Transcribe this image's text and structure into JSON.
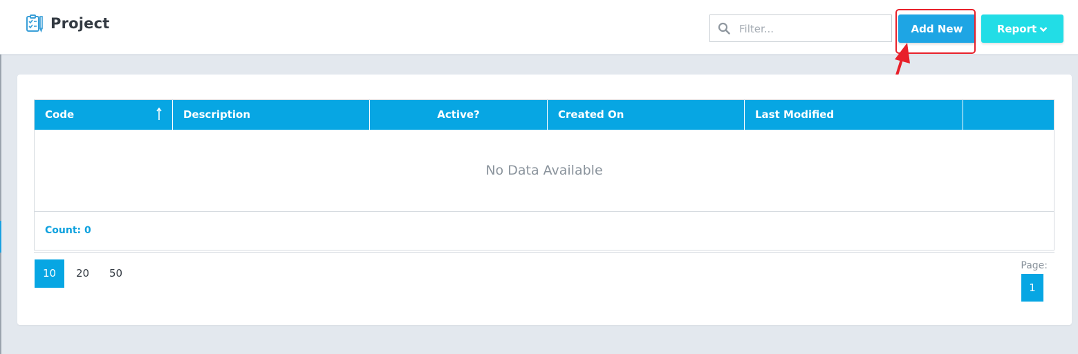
{
  "header": {
    "title": "Project",
    "title_icon": "clipboard-checklist-icon",
    "filter_placeholder": "Filter...",
    "filter_value": "",
    "add_new_label": "Add New",
    "report_label": "Report"
  },
  "grid": {
    "columns": [
      "Code",
      "Description",
      "Active?",
      "Created On",
      "Last Modified",
      ""
    ],
    "sorted_column": "Code",
    "sort_direction": "ascending",
    "empty_message": "No Data Available",
    "count_label": "Count: 0"
  },
  "pagination": {
    "page_sizes": [
      "10",
      "20",
      "50"
    ],
    "selected_page_size": "10",
    "page_label": "Page:",
    "current_page": "1"
  },
  "colors": {
    "primary": "#07a6e3",
    "add_button": "#1ea5e4",
    "report_button": "#22dde6",
    "annotation": "#e8202a",
    "background": "#e3e8ee"
  }
}
